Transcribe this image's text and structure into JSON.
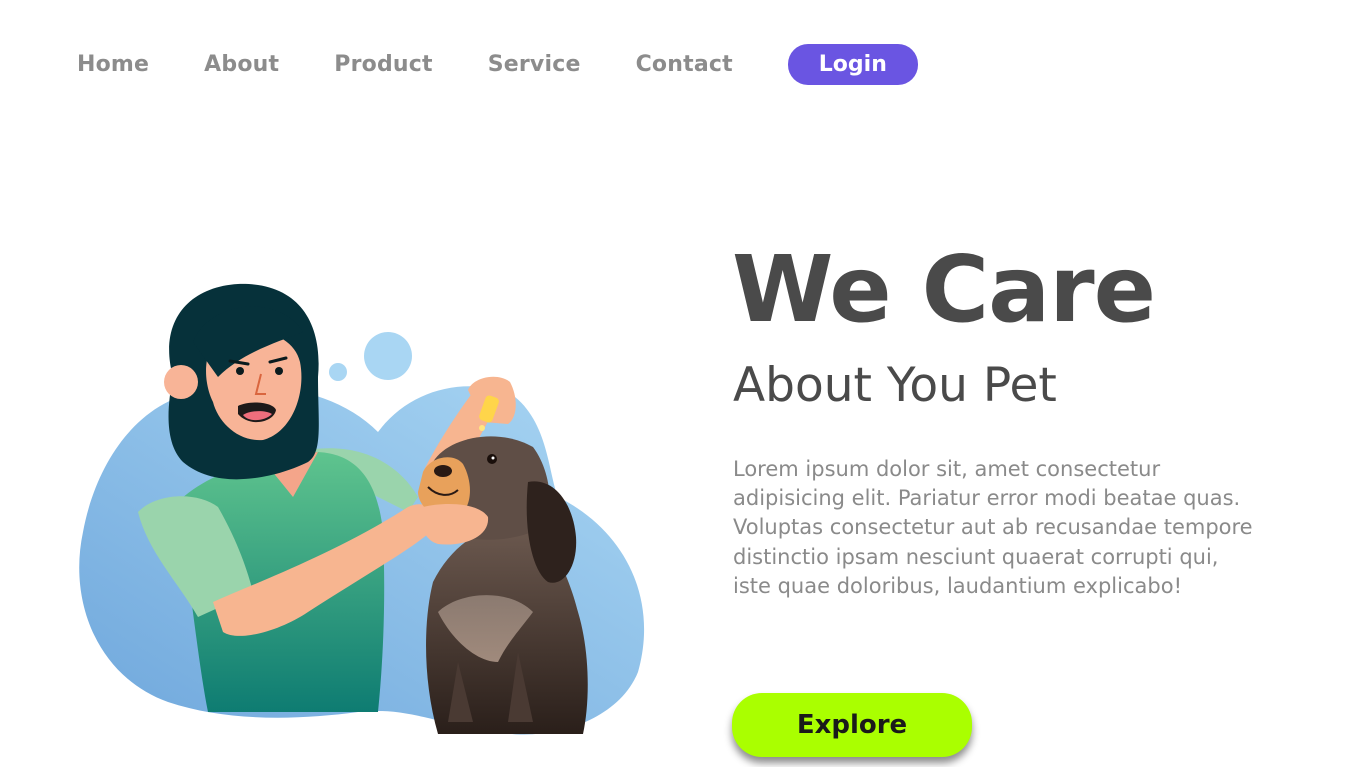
{
  "nav": {
    "links": [
      "Home",
      "About",
      "Product",
      "Service",
      "Contact"
    ],
    "login_label": "Login"
  },
  "hero": {
    "title": "We Care",
    "subtitle": "About You Pet",
    "body": "Lorem ipsum dolor sit, amet consectetur adipisicing elit. Pariatur error modi beatae quas. Voluptas consectetur aut ab recusandae tempore distinctio ipsam nesciunt quaerat corrupti qui, iste quae doloribus, laudantium explicabo!",
    "explore_label": "Explore"
  },
  "colors": {
    "accent": "#6a55e2",
    "button_green": "#aaff00",
    "heading": "#4a4a4a",
    "nav_text": "#8c8c8c",
    "body_text": "#8a8a8a"
  }
}
